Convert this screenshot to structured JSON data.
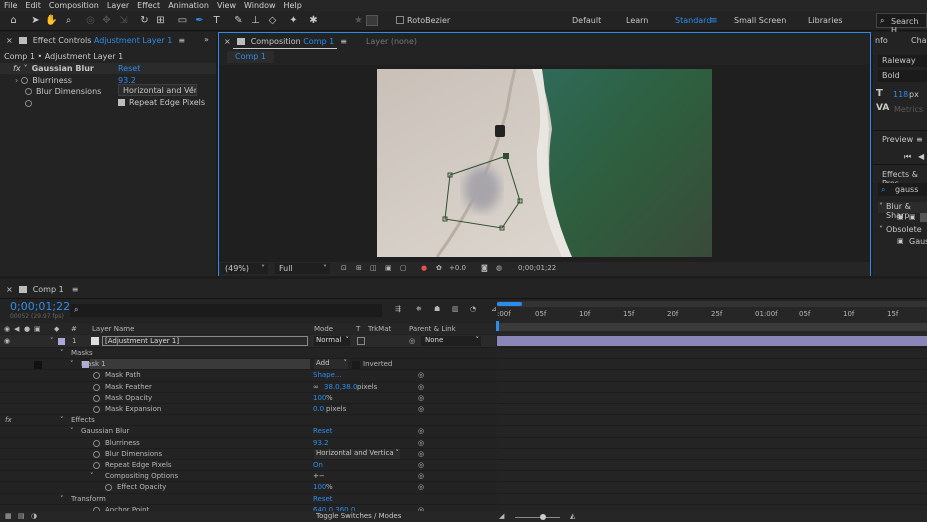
{
  "menu": [
    "File",
    "Edit",
    "Composition",
    "Layer",
    "Effect",
    "Animation",
    "View",
    "Window",
    "Help"
  ],
  "toolbar": {
    "roto": "RotoBezier",
    "workspaces": [
      "Default",
      "Learn",
      "Standard",
      "Small Screen",
      "Libraries"
    ],
    "search": "Search H"
  },
  "effect_controls": {
    "tab_prefix": "Effect Controls",
    "tab_layer": "Adjustment Layer 1",
    "breadcrumb": "Comp 1 • Adjustment Layer 1",
    "effect": "Gaussian Blur",
    "reset": "Reset",
    "blurriness_label": "Blurriness",
    "blurriness": "93.2",
    "dims_label": "Blur Dimensions",
    "dims": "Horizontal and Vert",
    "repeat": "Repeat Edge Pixels"
  },
  "composition": {
    "tab_prefix": "Composition",
    "tab_name": "Comp 1",
    "layer_tab": "Layer  (none)",
    "subtab": "Comp 1",
    "zoom": "(49%)",
    "quality": "Full",
    "exposure": "+0.0",
    "time": "0;00;01;22"
  },
  "right": {
    "info": "nfo",
    "char": "Char",
    "font": "Raleway",
    "style": "Bold",
    "size": "118",
    "size_unit": "px",
    "metrics": "Metrics",
    "preview": "Preview",
    "effects": "Effects & Pres",
    "search": "gauss",
    "blur": "Blur & Sharp",
    "obsolete": "Obsolete",
    "gauss": "Gauss"
  },
  "timeline": {
    "tab": "Comp 1",
    "timecode": "0;00;01;22",
    "fps": "00052 (29.97 fps)",
    "col_layer": "Layer Name",
    "col_mode": "Mode",
    "col_t": "T",
    "col_trkmat": "TrkMat",
    "col_parent": "Parent & Link",
    "layer_num": "1",
    "layer_name": "[Adjustment Layer 1]",
    "mode": "Normal",
    "parent": "None",
    "ruler": [
      ":00f",
      "05f",
      "10f",
      "15f",
      "20f",
      "25f",
      "01:00f",
      "05f",
      "10f",
      "15f"
    ],
    "toggle": "Toggle Switches / Modes",
    "props": [
      {
        "label": "Masks",
        "indent": 0,
        "value": ""
      },
      {
        "label": "Mask 1",
        "indent": 1,
        "value": "Add",
        "extra": "Inverted"
      },
      {
        "label": "Mask Path",
        "indent": 2,
        "value": "Shape..."
      },
      {
        "label": "Mask Feather",
        "indent": 2,
        "value": "38.0,38.0",
        "unit": "pixels"
      },
      {
        "label": "Mask Opacity",
        "indent": 2,
        "value": "100",
        "unit": "%"
      },
      {
        "label": "Mask Expansion",
        "indent": 2,
        "value": "0.0",
        "unit": "pixels"
      },
      {
        "label": "Effects",
        "indent": 0,
        "value": ""
      },
      {
        "label": "Gaussian Blur",
        "indent": 1,
        "value": "Reset"
      },
      {
        "label": "Blurriness",
        "indent": 2,
        "value": "93.2"
      },
      {
        "label": "Blur Dimensions",
        "indent": 2,
        "value": "Horizontal and Vertica"
      },
      {
        "label": "Repeat Edge Pixels",
        "indent": 2,
        "value": "On"
      },
      {
        "label": "Compositing Options",
        "indent": 2,
        "value": "+−"
      },
      {
        "label": "Effect Opacity",
        "indent": 3,
        "value": "100",
        "unit": "%"
      },
      {
        "label": "Transform",
        "indent": 0,
        "value": "Reset"
      },
      {
        "label": "Anchor Point",
        "indent": 2,
        "value": "640.0,360.0"
      }
    ]
  }
}
